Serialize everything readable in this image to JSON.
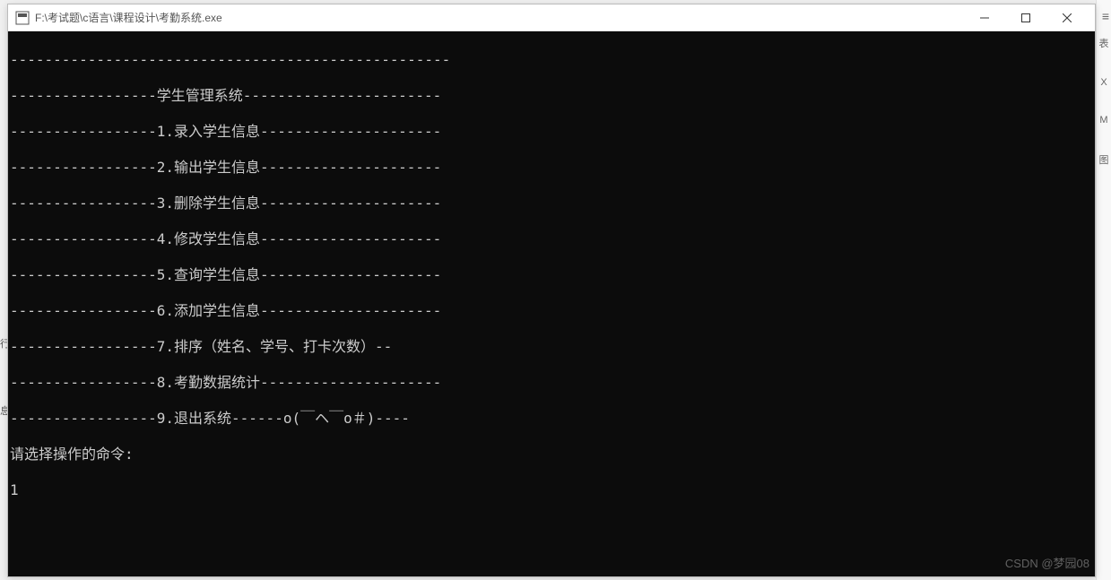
{
  "window": {
    "title": "F:\\考试题\\c语言\\课程设计\\考勤系统.exe"
  },
  "console": {
    "lines": [
      "---------------------------------------------------",
      "-----------------学生管理系统-----------------------",
      "-----------------1.录入学生信息---------------------",
      "-----------------2.输出学生信息---------------------",
      "-----------------3.删除学生信息---------------------",
      "-----------------4.修改学生信息---------------------",
      "-----------------5.查询学生信息---------------------",
      "-----------------6.添加学生信息---------------------",
      "-----------------7.排序（姓名、学号、打卡次数）--",
      "-----------------8.考勤数据统计---------------------",
      "-----------------9.退出系统------o(￣ヘ￣o＃)----"
    ],
    "prompt": "请选择操作的命令:",
    "input": "1"
  },
  "watermark": "CSDN @梦园08",
  "rightbar": {
    "items": [
      "表",
      "X",
      "M",
      "图"
    ]
  },
  "leftmarks": {
    "m1": "行",
    "m2": "息"
  },
  "menuicon": "≡"
}
